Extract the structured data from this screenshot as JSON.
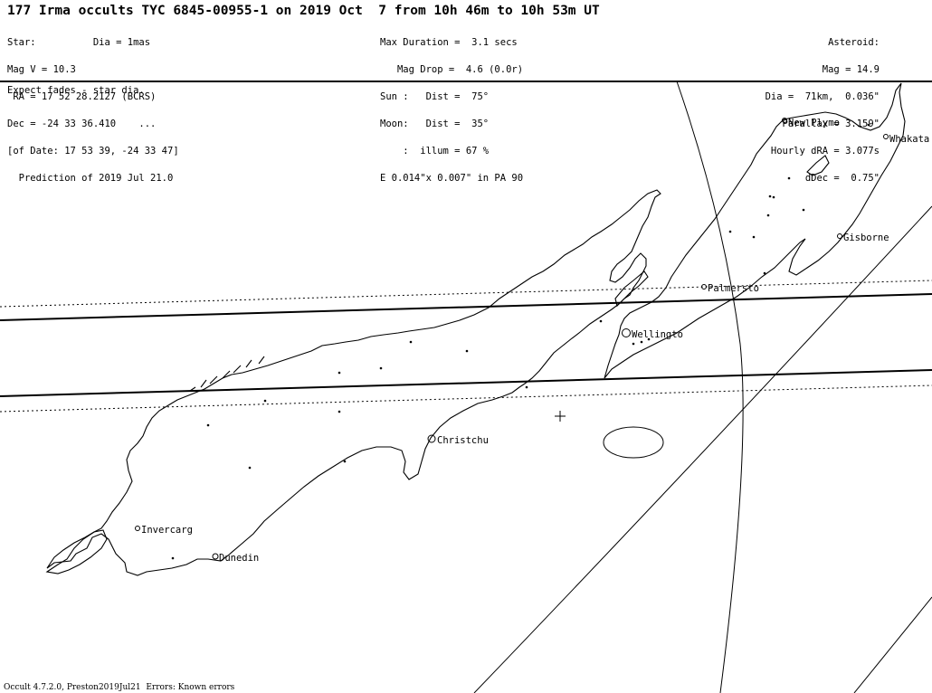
{
  "header": {
    "title": "177 Irma occults TYC 6845-00955-1 on 2019 Oct  7 from 10h 46m to 10h 53m UT",
    "star_lines": [
      "Star:          Dia = 1mas",
      "Mag V = 10.3",
      " RA = 17 52 28.2127 (BCRS)",
      "Dec = -24 33 36.410    ...",
      "[of Date: 17 53 39, -24 33 47]",
      "  Prediction of 2019 Jul 21.0"
    ],
    "event_lines": [
      "Max Duration =  3.1 secs",
      "   Mag Drop =  4.6 (0.0r)",
      "Sun :   Dist =  75°",
      "Moon:   Dist =  35°",
      "    :  illum = 67 %",
      "E 0.014\"x 0.007\" in PA 90"
    ],
    "asteroid_lines": [
      "Asteroid:",
      "Mag = 14.9",
      "Dia =  71km,  0.036\"",
      "Parallax = 3.159\"",
      "Hourly dRA = 3.077s",
      "dDec =  0.75\""
    ]
  },
  "note": "Expect fades - star dia.",
  "cities": [
    {
      "name": "New Plymo"
    },
    {
      "name": "Whakata"
    },
    {
      "name": "Gisborne"
    },
    {
      "name": "Palmersto"
    },
    {
      "name": "Wellingto"
    },
    {
      "name": "Christchu"
    },
    {
      "name": "Invercarg"
    },
    {
      "name": "Dunedin"
    }
  ],
  "footer": "Occult 4.7.2.0, Preston2019Jul21  Errors: Known errors"
}
